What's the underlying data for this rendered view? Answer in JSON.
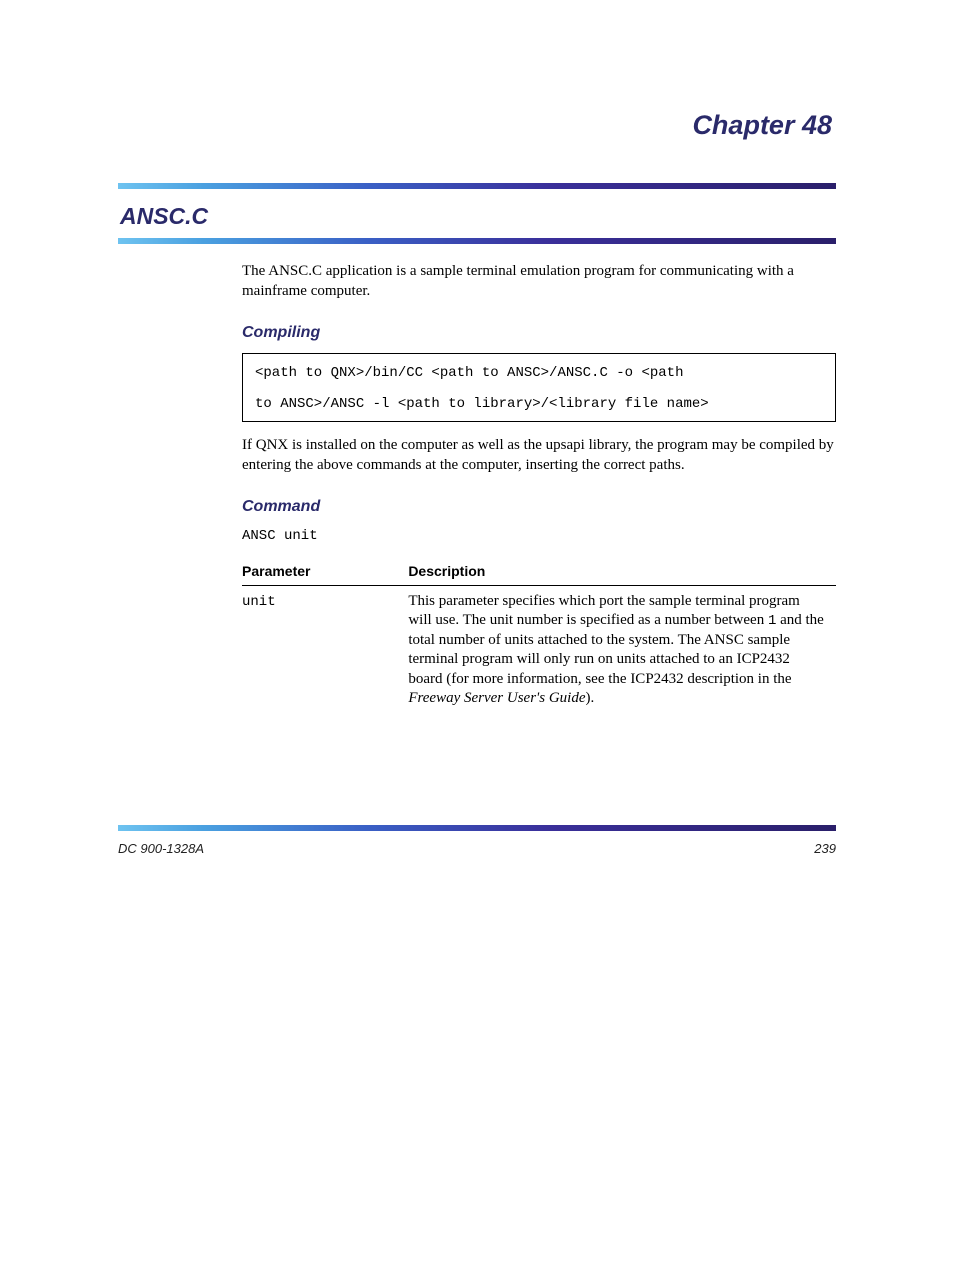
{
  "chapter_label": "Chapter 48",
  "title": "ANSC.C",
  "intro": "The ANSC.C application is a sample terminal emulation program for communicating with a mainframe computer.",
  "section_compiling": {
    "heading": "Compiling",
    "box_lines": [
      "<path to QNX>/bin/CC <path to ANSC>/ANSC.C -o <path",
      "to ANSC>/ANSC -l <path to library>/<library file name>"
    ],
    "post_text": "If QNX is installed on the computer as well as the upsapi library, the program may be compiled by entering the above commands at the computer, inserting the correct paths."
  },
  "section_command": {
    "heading": "Command",
    "cmd": "ANSC unit",
    "table": {
      "headers": [
        "Parameter",
        "Description"
      ],
      "rows": [
        {
          "param": "unit",
          "desc_pre": "This parameter specifies which port the sample terminal program will use. The unit number is specified as a number between ",
          "desc_mono": "1",
          "desc_mid": " and the total number of units attached to the system. The ANSC sample terminal program will only run on units attached to an ICP2432 board (for more information, see the ICP2432 description in the ",
          "desc_em": "Freeway Server User's Guide",
          "desc_post": ")."
        }
      ]
    }
  },
  "footer": {
    "left": "DC 900-1328A",
    "right": "239"
  }
}
